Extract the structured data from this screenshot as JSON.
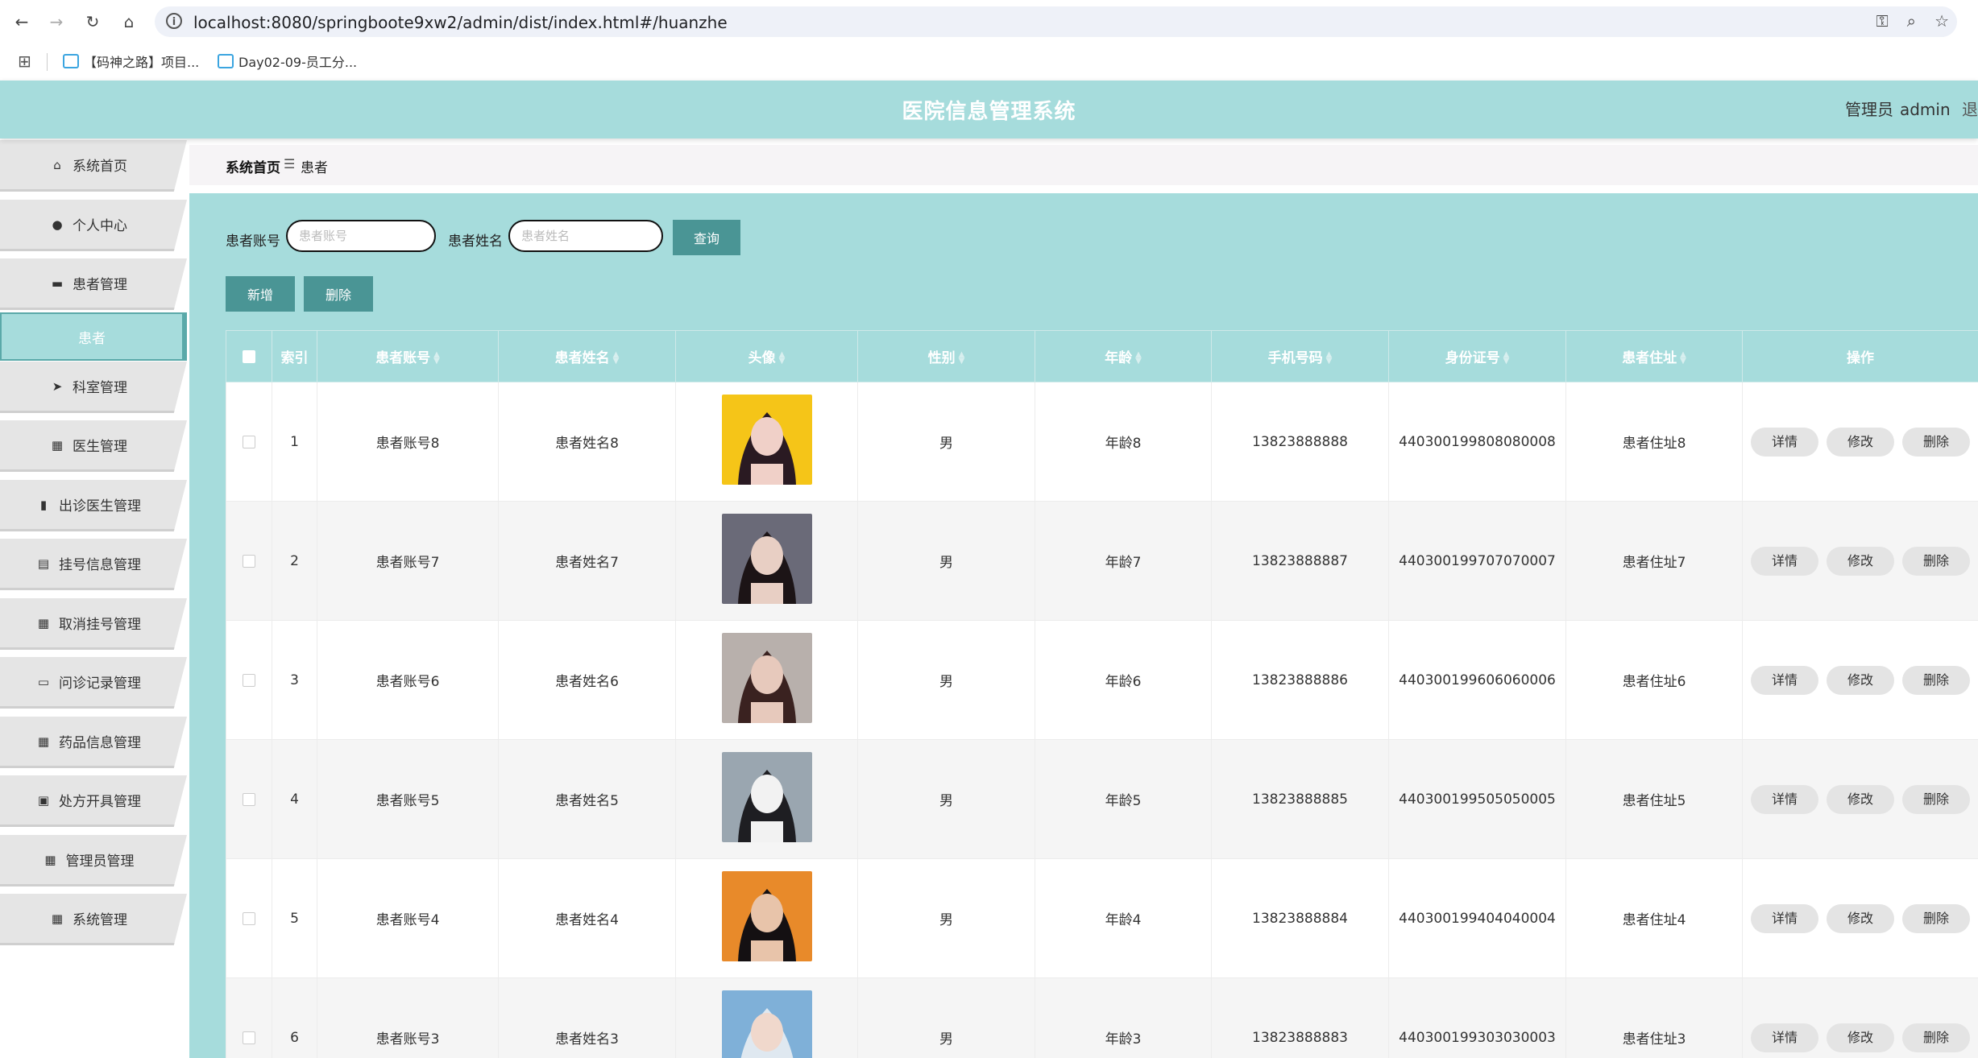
{
  "browser": {
    "url": "localhost:8080/springboote9xw2/admin/dist/index.html#/huanzhe",
    "bookmarks": [
      "【码神之路】项目...",
      "Day02-09-员工分..."
    ]
  },
  "header": {
    "title": "医院信息管理系统",
    "user_role": "管理员",
    "username": "admin",
    "logout": "退"
  },
  "sidebar": {
    "items": [
      {
        "label": "系统首页",
        "icon": "home-icon"
      },
      {
        "label": "个人中心",
        "icon": "user-icon"
      },
      {
        "label": "患者管理",
        "icon": "briefcase-icon"
      },
      {
        "label": "科室管理",
        "icon": "send-icon"
      },
      {
        "label": "医生管理",
        "icon": "grid-icon"
      },
      {
        "label": "出诊医生管理",
        "icon": "bar-chart-icon"
      },
      {
        "label": "挂号信息管理",
        "icon": "clipboard-icon"
      },
      {
        "label": "取消挂号管理",
        "icon": "grid-icon"
      },
      {
        "label": "问诊记录管理",
        "icon": "monitor-icon"
      },
      {
        "label": "药品信息管理",
        "icon": "grid-icon"
      },
      {
        "label": "处方开具管理",
        "icon": "ticket-icon"
      },
      {
        "label": "管理员管理",
        "icon": "grid-icon"
      },
      {
        "label": "系统管理",
        "icon": "grid-icon"
      }
    ],
    "active_sub": "患者"
  },
  "breadcrumb": {
    "home": "系统首页",
    "separator": "☰",
    "current": "患者"
  },
  "search": {
    "account_label": "患者账号",
    "account_placeholder": "患者账号",
    "name_label": "患者姓名",
    "name_placeholder": "患者姓名",
    "query_button": "查询"
  },
  "actions": {
    "add_button": "新增",
    "delete_button": "删除"
  },
  "table": {
    "columns": [
      "索引",
      "患者账号",
      "患者姓名",
      "头像",
      "性别",
      "年龄",
      "手机号码",
      "身份证号",
      "患者住址",
      "操作"
    ],
    "row_actions": [
      "详情",
      "修改",
      "删除"
    ],
    "rows": [
      {
        "index": "1",
        "account": "患者账号8",
        "name": "患者姓名8",
        "gender": "男",
        "age": "年龄8",
        "phone": "13823888888",
        "id_card": "440300199808080008",
        "address": "患者住址8"
      },
      {
        "index": "2",
        "account": "患者账号7",
        "name": "患者姓名7",
        "gender": "男",
        "age": "年龄7",
        "phone": "13823888887",
        "id_card": "440300199707070007",
        "address": "患者住址7"
      },
      {
        "index": "3",
        "account": "患者账号6",
        "name": "患者姓名6",
        "gender": "男",
        "age": "年龄6",
        "phone": "13823888886",
        "id_card": "440300199606060006",
        "address": "患者住址6"
      },
      {
        "index": "4",
        "account": "患者账号5",
        "name": "患者姓名5",
        "gender": "男",
        "age": "年龄5",
        "phone": "13823888885",
        "id_card": "440300199505050005",
        "address": "患者住址5"
      },
      {
        "index": "5",
        "account": "患者账号4",
        "name": "患者姓名4",
        "gender": "男",
        "age": "年龄4",
        "phone": "13823888884",
        "id_card": "440300199404040004",
        "address": "患者住址4"
      },
      {
        "index": "6",
        "account": "患者账号3",
        "name": "患者姓名3",
        "gender": "男",
        "age": "年龄3",
        "phone": "13823888883",
        "id_card": "440300199303030003",
        "address": "患者住址3"
      }
    ]
  },
  "colors": {
    "theme": "#a6dcdc",
    "button": "#4a9595",
    "title_text": "#ffffff"
  }
}
